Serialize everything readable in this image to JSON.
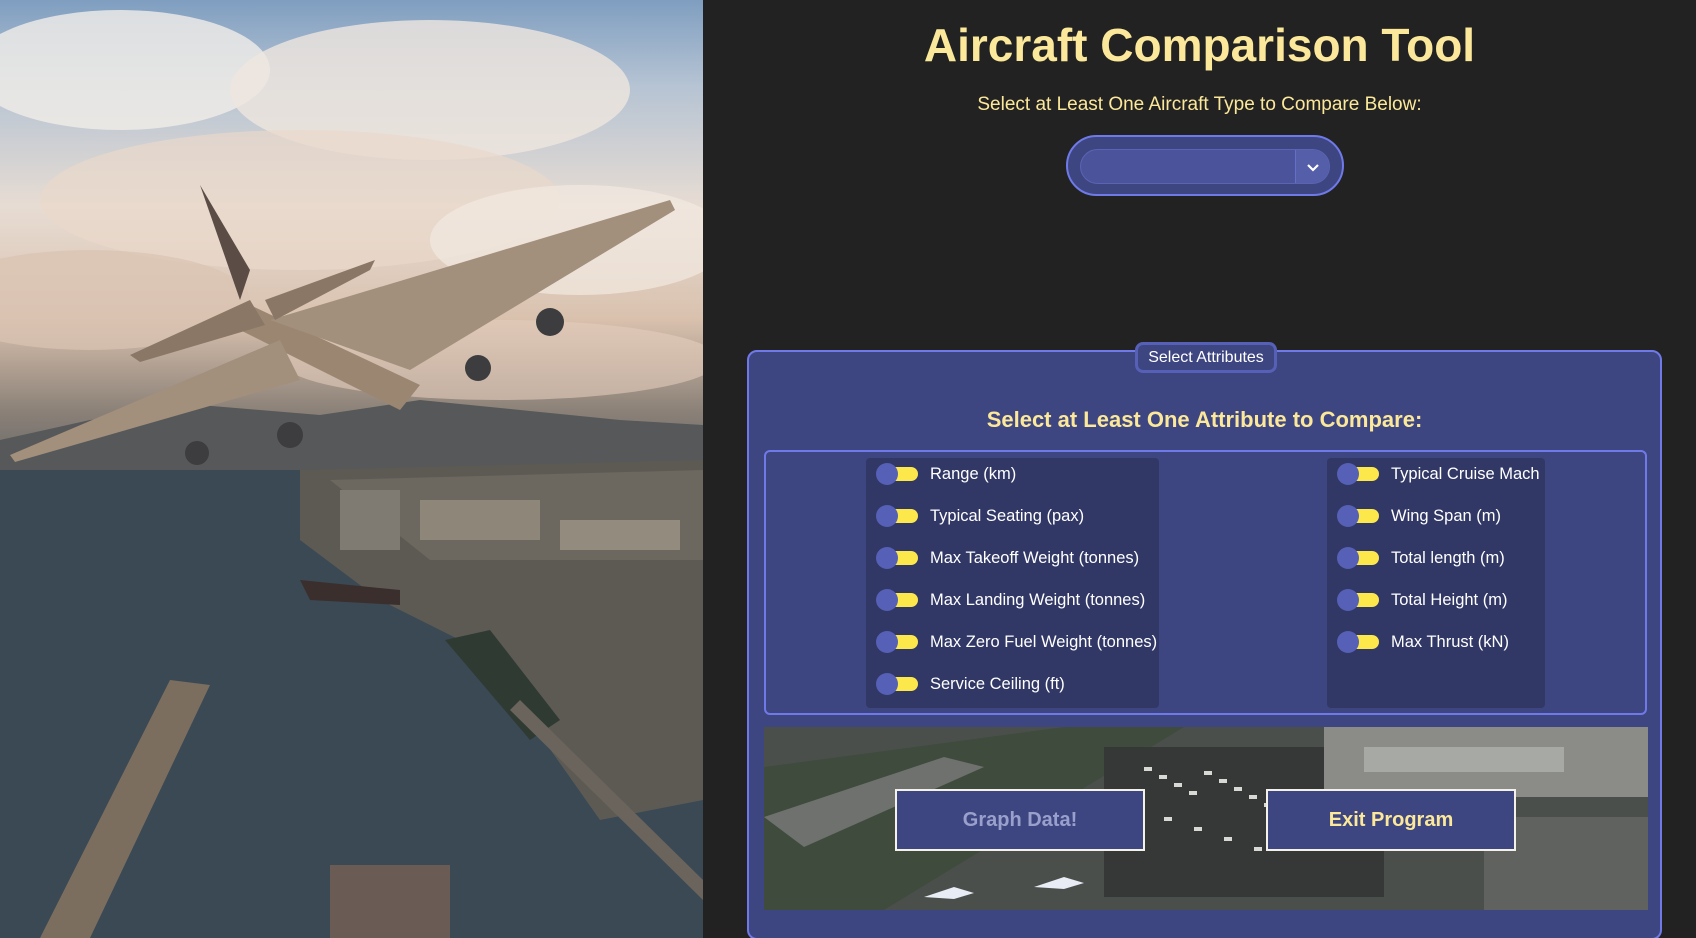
{
  "app": {
    "title": "Aircraft Comparison Tool",
    "subtitle": "Select at Least One Aircraft Type to Compare Below:",
    "aircraft_select": {
      "value": "",
      "icon": "chevron-down-icon"
    }
  },
  "attributes": {
    "legend": "Select Attributes",
    "heading": "Select at Least One Attribute to Compare:",
    "left": [
      {
        "label": "Range (km)",
        "on": true
      },
      {
        "label": "Typical Seating (pax)",
        "on": true
      },
      {
        "label": "Max Takeoff Weight (tonnes)",
        "on": true
      },
      {
        "label": "Max Landing Weight (tonnes)",
        "on": true
      },
      {
        "label": "Max Zero Fuel Weight (tonnes)",
        "on": true
      },
      {
        "label": "Service Ceiling (ft)",
        "on": true
      }
    ],
    "right": [
      {
        "label": "Typical Cruise Mach",
        "on": true
      },
      {
        "label": "Wing Span (m)",
        "on": true
      },
      {
        "label": "Total length (m)",
        "on": true
      },
      {
        "label": "Total Height (m)",
        "on": true
      },
      {
        "label": "Max Thrust (kN)",
        "on": true
      }
    ]
  },
  "actions": {
    "graph_label": "Graph Data!",
    "exit_label": "Exit Program"
  },
  "colors": {
    "background": "#222222",
    "accent_text": "#fbe89a",
    "panel": "#3e4681",
    "border": "#6f7ae8",
    "toggle_on": "#fde84c"
  }
}
